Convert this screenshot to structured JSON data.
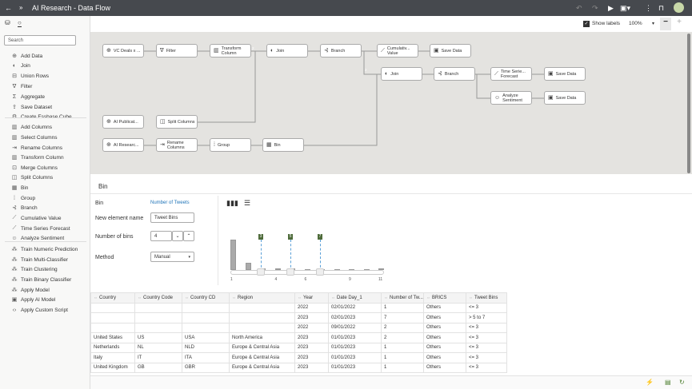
{
  "app": {
    "title": "AI Research - Data Flow"
  },
  "toolbar": {
    "show_labels": "Show labels",
    "show_labels_checked": true,
    "zoom": "100%",
    "zoom_out": "−",
    "zoom_in": "+"
  },
  "sidebar": {
    "search_placeholder": "Search",
    "items": [
      {
        "label": "Add Data",
        "icon": "⊕"
      },
      {
        "label": "Join",
        "icon": "◐"
      },
      {
        "label": "Union Rows",
        "icon": "⊟"
      },
      {
        "label": "Filter",
        "icon": "∇"
      },
      {
        "label": "Aggregate",
        "icon": "Σ"
      },
      {
        "label": "Save Dataset",
        "icon": "⇪"
      },
      {
        "label": "Create Essbase Cube",
        "icon": "⚙"
      },
      {
        "label": "Add Columns",
        "icon": "▥"
      },
      {
        "label": "Select Columns",
        "icon": "▥"
      },
      {
        "label": "Rename Columns",
        "icon": "⇥"
      },
      {
        "label": "Transform Column",
        "icon": "▥"
      },
      {
        "label": "Merge Columns",
        "icon": "⊡"
      },
      {
        "label": "Split Columns",
        "icon": "◫"
      },
      {
        "label": "Bin",
        "icon": "▦"
      },
      {
        "label": "Group",
        "icon": "⁞"
      },
      {
        "label": "Branch",
        "icon": "⊰"
      },
      {
        "label": "Cumulative Value",
        "icon": "⟋"
      },
      {
        "label": "Time Series Forecast",
        "icon": "⟋"
      },
      {
        "label": "Analyze Sentiment",
        "icon": "☺"
      },
      {
        "label": "Train Numeric Prediction",
        "icon": "⁂"
      },
      {
        "label": "Train Multi-Classifier",
        "icon": "⁂"
      },
      {
        "label": "Train Clustering",
        "icon": "⁂"
      },
      {
        "label": "Train Binary Classifier",
        "icon": "⁂"
      },
      {
        "label": "Apply Model",
        "icon": "⁂"
      },
      {
        "label": "Apply AI Model",
        "icon": "▣"
      },
      {
        "label": "Apply Custom Script",
        "icon": "‹›"
      }
    ]
  },
  "flow": {
    "nodes": [
      {
        "label": "VC Deals x ...",
        "icon": "⊕"
      },
      {
        "label": "Filter",
        "icon": "∇"
      },
      {
        "label": "Transform Column",
        "icon": "▥"
      },
      {
        "label": "Join",
        "icon": "◐"
      },
      {
        "label": "Branch",
        "icon": "⊰"
      },
      {
        "label": "Cumulativ... Value",
        "icon": "⟋"
      },
      {
        "label": "Save Data",
        "icon": "▣"
      },
      {
        "label": "Join",
        "icon": "◐"
      },
      {
        "label": "Branch",
        "icon": "⊰"
      },
      {
        "label": "Time Serie... Forecast",
        "icon": "⟋"
      },
      {
        "label": "Save Data",
        "icon": "▣"
      },
      {
        "label": "Analyze Sentiment",
        "icon": "☺"
      },
      {
        "label": "Save Data",
        "icon": "▣"
      },
      {
        "label": "AI Publicat...",
        "icon": "⊕"
      },
      {
        "label": "Split Columns",
        "icon": "◫"
      },
      {
        "label": "AI Researc...",
        "icon": "⊕"
      },
      {
        "label": "Rename Columns",
        "icon": "⇥"
      },
      {
        "label": "Group",
        "icon": "⁞"
      },
      {
        "label": "Bin",
        "icon": "▦"
      }
    ],
    "port_labels": [
      "2",
      "2"
    ]
  },
  "bin": {
    "title": "Bin",
    "bin_label": "Bin",
    "bin_column": "Number of Tweets",
    "name_label": "New element name",
    "name_value": "Tweet Bins",
    "bins_label": "Number of bins",
    "bins_value": "4",
    "method_label": "Method",
    "method_value": "Manual",
    "histogram": {
      "x_ticks": [
        "1",
        "4",
        "6",
        "9",
        "11"
      ],
      "counts": [
        10,
        2.5,
        0.6,
        0.4,
        0.4,
        0.2,
        0.2,
        0.2,
        0.2,
        0.2,
        0.6
      ],
      "x_range": [
        1,
        11
      ],
      "boundaries": [
        3,
        5,
        7
      ],
      "boundary_labels": [
        "3",
        "5",
        "7"
      ]
    }
  },
  "table": {
    "columns": [
      "Country",
      "Country Code",
      "Country CD",
      "Region",
      "Year",
      "Date Day_1",
      "Number of Tw...",
      "BRICS",
      "Tweet Bins"
    ],
    "rows": [
      [
        "",
        "",
        "",
        "",
        "2022",
        "02/01/2022",
        "1",
        "Others",
        "<= 3"
      ],
      [
        "",
        "",
        "",
        "",
        "2023",
        "02/01/2023",
        "7",
        "Others",
        "> 5 to 7"
      ],
      [
        "",
        "",
        "",
        "",
        "2022",
        "09/01/2022",
        "2",
        "Others",
        "<= 3"
      ],
      [
        "United States",
        "US",
        "USA",
        "North America",
        "2023",
        "01/01/2023",
        "2",
        "Others",
        "<= 3"
      ],
      [
        "Netherlands",
        "NL",
        "NLD",
        "Europe & Central Asia",
        "2023",
        "01/01/2023",
        "1",
        "Others",
        "<= 3"
      ],
      [
        "Italy",
        "IT",
        "ITA",
        "Europe & Central Asia",
        "2023",
        "01/01/2023",
        "1",
        "Others",
        "<= 3"
      ],
      [
        "United Kingdom",
        "GB",
        "GBR",
        "Europe & Central Asia",
        "2023",
        "01/01/2023",
        "1",
        "Others",
        "<= 3"
      ]
    ]
  },
  "colors": {
    "topbar": "#46494e",
    "canvas": "#e4e3e0",
    "link": "#1f74b8",
    "marker": "#4e6b3a"
  }
}
